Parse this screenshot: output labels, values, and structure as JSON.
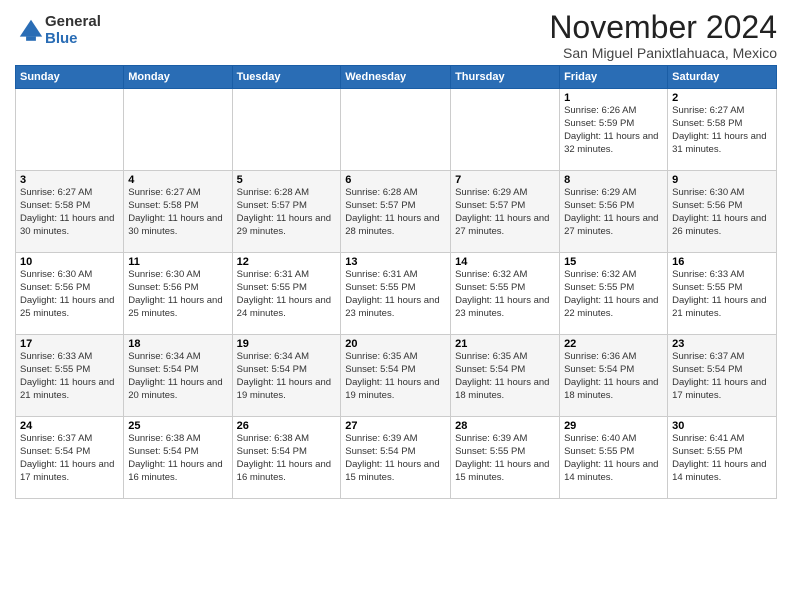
{
  "header": {
    "logo_general": "General",
    "logo_blue": "Blue",
    "month": "November 2024",
    "location": "San Miguel Panixtlahuaca, Mexico"
  },
  "calendar": {
    "days_of_week": [
      "Sunday",
      "Monday",
      "Tuesday",
      "Wednesday",
      "Thursday",
      "Friday",
      "Saturday"
    ],
    "weeks": [
      [
        {
          "day": "",
          "sunrise": "",
          "sunset": "",
          "daylight": ""
        },
        {
          "day": "",
          "sunrise": "",
          "sunset": "",
          "daylight": ""
        },
        {
          "day": "",
          "sunrise": "",
          "sunset": "",
          "daylight": ""
        },
        {
          "day": "",
          "sunrise": "",
          "sunset": "",
          "daylight": ""
        },
        {
          "day": "",
          "sunrise": "",
          "sunset": "",
          "daylight": ""
        },
        {
          "day": "1",
          "sunrise": "Sunrise: 6:26 AM",
          "sunset": "Sunset: 5:59 PM",
          "daylight": "Daylight: 11 hours and 32 minutes."
        },
        {
          "day": "2",
          "sunrise": "Sunrise: 6:27 AM",
          "sunset": "Sunset: 5:58 PM",
          "daylight": "Daylight: 11 hours and 31 minutes."
        }
      ],
      [
        {
          "day": "3",
          "sunrise": "Sunrise: 6:27 AM",
          "sunset": "Sunset: 5:58 PM",
          "daylight": "Daylight: 11 hours and 30 minutes."
        },
        {
          "day": "4",
          "sunrise": "Sunrise: 6:27 AM",
          "sunset": "Sunset: 5:58 PM",
          "daylight": "Daylight: 11 hours and 30 minutes."
        },
        {
          "day": "5",
          "sunrise": "Sunrise: 6:28 AM",
          "sunset": "Sunset: 5:57 PM",
          "daylight": "Daylight: 11 hours and 29 minutes."
        },
        {
          "day": "6",
          "sunrise": "Sunrise: 6:28 AM",
          "sunset": "Sunset: 5:57 PM",
          "daylight": "Daylight: 11 hours and 28 minutes."
        },
        {
          "day": "7",
          "sunrise": "Sunrise: 6:29 AM",
          "sunset": "Sunset: 5:57 PM",
          "daylight": "Daylight: 11 hours and 27 minutes."
        },
        {
          "day": "8",
          "sunrise": "Sunrise: 6:29 AM",
          "sunset": "Sunset: 5:56 PM",
          "daylight": "Daylight: 11 hours and 27 minutes."
        },
        {
          "day": "9",
          "sunrise": "Sunrise: 6:30 AM",
          "sunset": "Sunset: 5:56 PM",
          "daylight": "Daylight: 11 hours and 26 minutes."
        }
      ],
      [
        {
          "day": "10",
          "sunrise": "Sunrise: 6:30 AM",
          "sunset": "Sunset: 5:56 PM",
          "daylight": "Daylight: 11 hours and 25 minutes."
        },
        {
          "day": "11",
          "sunrise": "Sunrise: 6:30 AM",
          "sunset": "Sunset: 5:56 PM",
          "daylight": "Daylight: 11 hours and 25 minutes."
        },
        {
          "day": "12",
          "sunrise": "Sunrise: 6:31 AM",
          "sunset": "Sunset: 5:55 PM",
          "daylight": "Daylight: 11 hours and 24 minutes."
        },
        {
          "day": "13",
          "sunrise": "Sunrise: 6:31 AM",
          "sunset": "Sunset: 5:55 PM",
          "daylight": "Daylight: 11 hours and 23 minutes."
        },
        {
          "day": "14",
          "sunrise": "Sunrise: 6:32 AM",
          "sunset": "Sunset: 5:55 PM",
          "daylight": "Daylight: 11 hours and 23 minutes."
        },
        {
          "day": "15",
          "sunrise": "Sunrise: 6:32 AM",
          "sunset": "Sunset: 5:55 PM",
          "daylight": "Daylight: 11 hours and 22 minutes."
        },
        {
          "day": "16",
          "sunrise": "Sunrise: 6:33 AM",
          "sunset": "Sunset: 5:55 PM",
          "daylight": "Daylight: 11 hours and 21 minutes."
        }
      ],
      [
        {
          "day": "17",
          "sunrise": "Sunrise: 6:33 AM",
          "sunset": "Sunset: 5:55 PM",
          "daylight": "Daylight: 11 hours and 21 minutes."
        },
        {
          "day": "18",
          "sunrise": "Sunrise: 6:34 AM",
          "sunset": "Sunset: 5:54 PM",
          "daylight": "Daylight: 11 hours and 20 minutes."
        },
        {
          "day": "19",
          "sunrise": "Sunrise: 6:34 AM",
          "sunset": "Sunset: 5:54 PM",
          "daylight": "Daylight: 11 hours and 19 minutes."
        },
        {
          "day": "20",
          "sunrise": "Sunrise: 6:35 AM",
          "sunset": "Sunset: 5:54 PM",
          "daylight": "Daylight: 11 hours and 19 minutes."
        },
        {
          "day": "21",
          "sunrise": "Sunrise: 6:35 AM",
          "sunset": "Sunset: 5:54 PM",
          "daylight": "Daylight: 11 hours and 18 minutes."
        },
        {
          "day": "22",
          "sunrise": "Sunrise: 6:36 AM",
          "sunset": "Sunset: 5:54 PM",
          "daylight": "Daylight: 11 hours and 18 minutes."
        },
        {
          "day": "23",
          "sunrise": "Sunrise: 6:37 AM",
          "sunset": "Sunset: 5:54 PM",
          "daylight": "Daylight: 11 hours and 17 minutes."
        }
      ],
      [
        {
          "day": "24",
          "sunrise": "Sunrise: 6:37 AM",
          "sunset": "Sunset: 5:54 PM",
          "daylight": "Daylight: 11 hours and 17 minutes."
        },
        {
          "day": "25",
          "sunrise": "Sunrise: 6:38 AM",
          "sunset": "Sunset: 5:54 PM",
          "daylight": "Daylight: 11 hours and 16 minutes."
        },
        {
          "day": "26",
          "sunrise": "Sunrise: 6:38 AM",
          "sunset": "Sunset: 5:54 PM",
          "daylight": "Daylight: 11 hours and 16 minutes."
        },
        {
          "day": "27",
          "sunrise": "Sunrise: 6:39 AM",
          "sunset": "Sunset: 5:54 PM",
          "daylight": "Daylight: 11 hours and 15 minutes."
        },
        {
          "day": "28",
          "sunrise": "Sunrise: 6:39 AM",
          "sunset": "Sunset: 5:55 PM",
          "daylight": "Daylight: 11 hours and 15 minutes."
        },
        {
          "day": "29",
          "sunrise": "Sunrise: 6:40 AM",
          "sunset": "Sunset: 5:55 PM",
          "daylight": "Daylight: 11 hours and 14 minutes."
        },
        {
          "day": "30",
          "sunrise": "Sunrise: 6:41 AM",
          "sunset": "Sunset: 5:55 PM",
          "daylight": "Daylight: 11 hours and 14 minutes."
        }
      ]
    ]
  }
}
